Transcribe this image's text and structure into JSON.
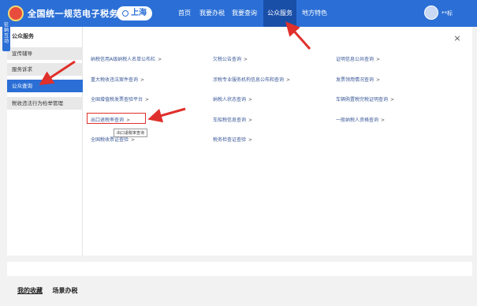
{
  "header": {
    "site_title": "全国统一规范电子税务局",
    "region": "上海",
    "nav": [
      {
        "label": "首页"
      },
      {
        "label": "我要办税"
      },
      {
        "label": "我要查询"
      },
      {
        "label": "公众服务"
      },
      {
        "label": "地方特色"
      }
    ],
    "user_name": "**标"
  },
  "side_tab": {
    "label": "征纳互动"
  },
  "sidebar": {
    "title": "公众服务",
    "items": [
      {
        "label": "宣传辅导"
      },
      {
        "label": "服务诉求"
      },
      {
        "label": "公众查询"
      },
      {
        "label": "税收违法行为检举管理"
      }
    ]
  },
  "panel": {
    "close": "×",
    "links": [
      {
        "label": "纳税信用A级纳税人名单公布栏"
      },
      {
        "label": "欠税公告查询"
      },
      {
        "label": "证明信息公共查询"
      },
      {
        "label": "重大税收违法案件查询"
      },
      {
        "label": "涉税专业服务机构信息公布和查询"
      },
      {
        "label": "发票领用情况查询"
      },
      {
        "label": "全国增值税发票查验平台"
      },
      {
        "label": "纳税人状态查询"
      },
      {
        "label": "车辆购置税完税证明查询"
      },
      {
        "label": "出口退税率查询"
      },
      {
        "label": "车船税信息查询"
      },
      {
        "label": "一般纳税人资格查询"
      },
      {
        "label": "全国税收票证查验"
      },
      {
        "label": "税务检查证查验"
      }
    ],
    "chevron": ">",
    "tooltip": "出口退税率查询"
  },
  "bottom": {
    "tab1": "我的收藏",
    "tab2": "场景办税"
  },
  "colors": {
    "brand_blue": "#2b6fd6",
    "annotation_red": "#e0302b"
  }
}
